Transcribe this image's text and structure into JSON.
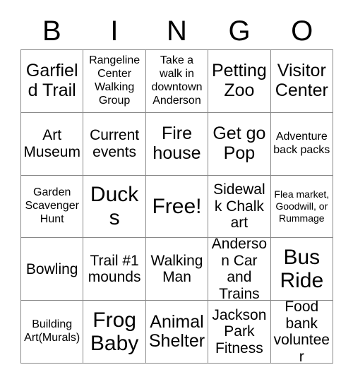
{
  "header": {
    "letters": [
      "B",
      "I",
      "N",
      "G",
      "O"
    ]
  },
  "grid": {
    "rows": 5,
    "columns": 5,
    "cells": [
      {
        "text": "Garfield Trail",
        "size": "lg"
      },
      {
        "text": "Rangeline Center Walking Group",
        "size": "sm"
      },
      {
        "text": "Take a walk in downtown Anderson",
        "size": "sm"
      },
      {
        "text": "Petting Zoo",
        "size": "lg"
      },
      {
        "text": "Visitor Center",
        "size": "lg"
      },
      {
        "text": "Art Museum",
        "size": "md"
      },
      {
        "text": "Current events",
        "size": "md"
      },
      {
        "text": "Fire house",
        "size": "lg"
      },
      {
        "text": "Get go Pop",
        "size": "lg"
      },
      {
        "text": "Adventure back packs",
        "size": "sm"
      },
      {
        "text": "Garden Scavenger Hunt",
        "size": "sm"
      },
      {
        "text": "Ducks",
        "size": "xl"
      },
      {
        "text": "Free!",
        "size": "xl"
      },
      {
        "text": "Sidewalk Chalk art",
        "size": "md"
      },
      {
        "text": "Flea market, Goodwill, or Rummage",
        "size": "xs"
      },
      {
        "text": "Bowling",
        "size": "md"
      },
      {
        "text": "Trail #1 mounds",
        "size": "md"
      },
      {
        "text": "Walking Man",
        "size": "md"
      },
      {
        "text": "Anderson Car and Trains",
        "size": "md"
      },
      {
        "text": "Bus Ride",
        "size": "xl"
      },
      {
        "text": "Building Art(Murals)",
        "size": "sm"
      },
      {
        "text": "Frog Baby",
        "size": "xl"
      },
      {
        "text": "Animal Shelter",
        "size": "lg"
      },
      {
        "text": "Jackson Park Fitness",
        "size": "md"
      },
      {
        "text": "Food bank volunteer",
        "size": "md"
      }
    ]
  },
  "colors": {
    "background": "#ffffff",
    "text": "#000000",
    "grid_line": "#888888"
  }
}
